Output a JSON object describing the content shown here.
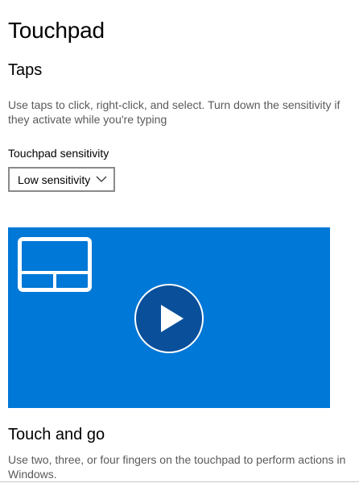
{
  "page": {
    "title": "Touchpad"
  },
  "taps": {
    "heading": "Taps",
    "description": "Use taps to click, right-click, and select. Turn down the sensitivity if they activate while you're typing",
    "sensitivity_label": "Touchpad sensitivity",
    "sensitivity_value": "Low sensitivity"
  },
  "video": {
    "background_color": "#0078d7",
    "play_button_color": "#0a4f9a",
    "icons": [
      "touchpad-icon",
      "play-icon"
    ]
  },
  "touch_and_go": {
    "heading": "Touch and go",
    "description": "Use two, three, or four fingers on the touchpad to perform actions in Windows."
  }
}
